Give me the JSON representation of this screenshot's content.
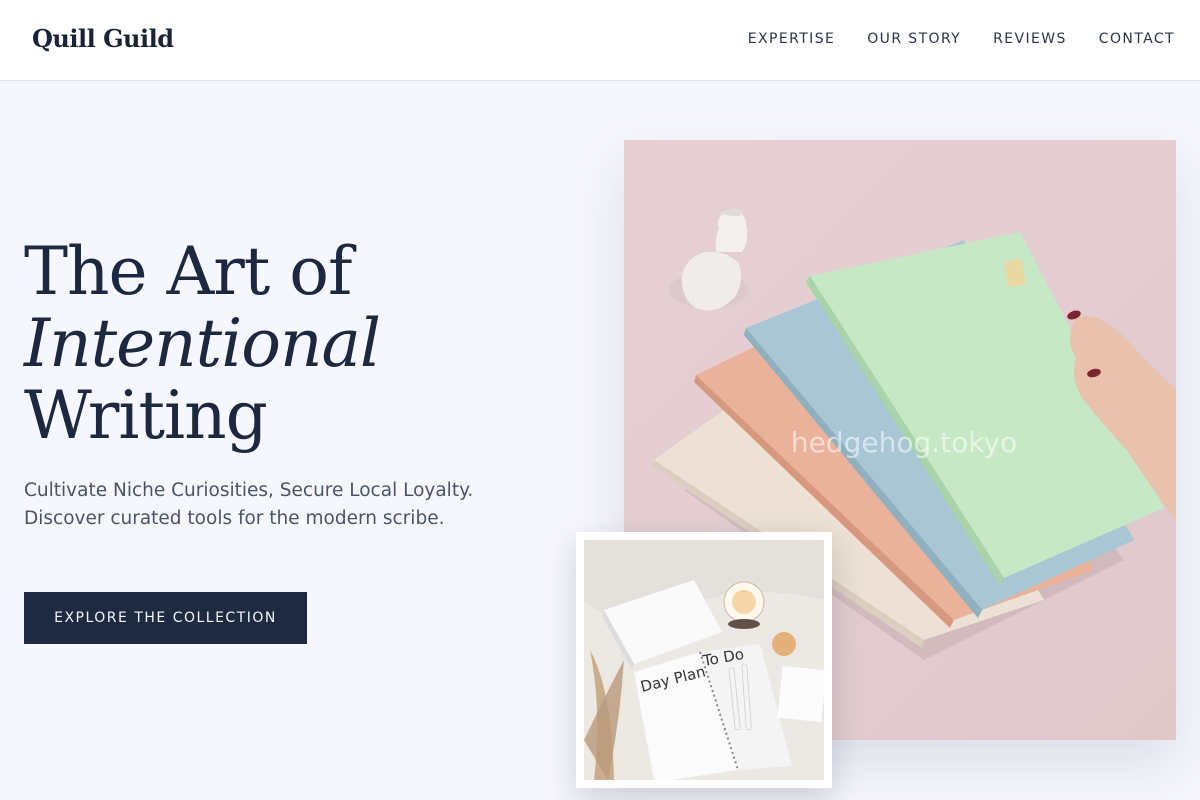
{
  "header": {
    "logo": "Quill Guild",
    "nav": [
      "EXPERTISE",
      "OUR STORY",
      "REVIEWS",
      "CONTACT"
    ]
  },
  "hero": {
    "title_line1": "The Art of",
    "title_line2": "Intentional",
    "title_line3": "Writing",
    "subtitle": "Cultivate Niche Curiosities, Secure Local Loyalty. Discover curated tools for the modern scribe.",
    "cta_label": "EXPLORE THE COLLECTION"
  },
  "images": {
    "main_watermark": "hedgehog.tokyo",
    "inset_planner_left": "Day Plan",
    "inset_planner_right": "To Do"
  },
  "colors": {
    "background": "#f6f7fd",
    "navy": "#1e2a3f",
    "photo_pink": "#e4ced1",
    "notebook_green": "#c6e8c4",
    "notebook_blue": "#a7c5d3",
    "notebook_peach": "#eab29a",
    "notebook_cream": "#ece2d6"
  }
}
